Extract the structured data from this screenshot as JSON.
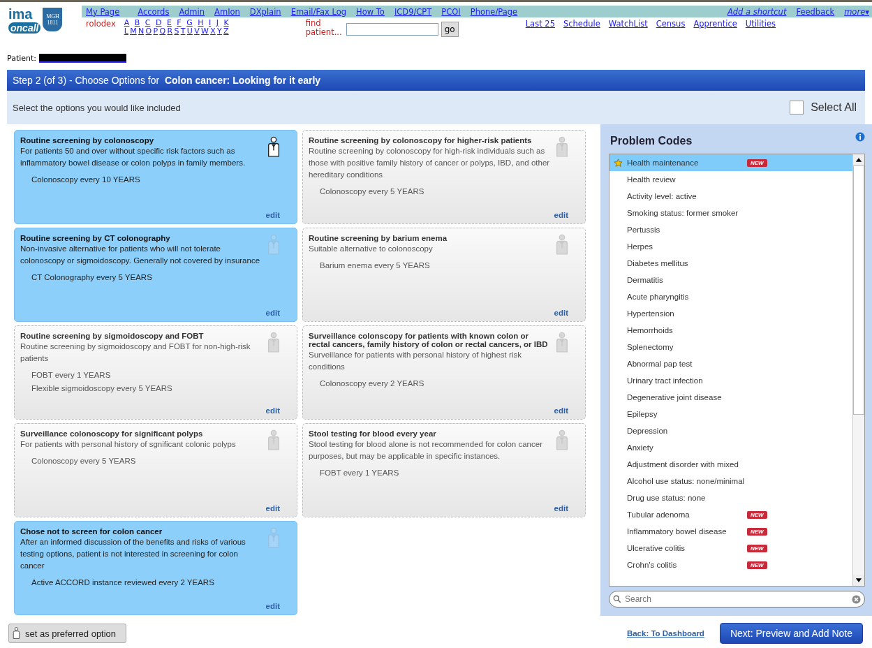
{
  "logo": {
    "line1": "ima",
    "line2": "oncall",
    "shield_top": "MGH",
    "shield_year": "1811"
  },
  "nav_links": [
    "My Page",
    "Accords",
    "Admin",
    "AmIon",
    "DXplain",
    "Email/Fax Log",
    "How To",
    "ICD9/CPT",
    "PCOI",
    "Phone/Page"
  ],
  "nav_right_links": [
    {
      "label": "Add a shortcut",
      "italic": true
    },
    {
      "label": "Feedback",
      "italic": false
    },
    {
      "label": "more▾",
      "italic": true
    }
  ],
  "rolodex": {
    "label": "rolodex",
    "first_line": [
      "A",
      "B",
      "C",
      "D",
      "E",
      "F",
      "G",
      "H",
      "I",
      "J",
      "K"
    ],
    "second_line": [
      "L",
      "M",
      "N",
      "O",
      "P",
      "Q",
      "R",
      "S",
      "T",
      "U",
      "V",
      "W",
      "X",
      "Y",
      "Z"
    ]
  },
  "find_patient": {
    "label": "find patient...",
    "button": "go"
  },
  "secondary_links": [
    "Last 25",
    "Schedule",
    "WatchList",
    "Census",
    "Apprentice",
    "Utilities"
  ],
  "patient_label": "Patient:",
  "step": {
    "prefix": "Step 2 (of 3) - Choose Options for",
    "topic": "Colon cancer: Looking for it early"
  },
  "instruction": "Select the options you would like included",
  "select_all": {
    "label": "Select All",
    "checked": false
  },
  "cards": [
    {
      "title": "Routine screening by colonoscopy",
      "description": "For patients 50 and over without specific risk factors such as inflammatory bowel disease or colon polyps in family members.",
      "schedules": [
        "Colonoscopy every 10 YEARS"
      ],
      "edit": "edit",
      "selected": true,
      "preferred": true
    },
    {
      "title": "Routine screening by colonoscopy for higher-risk patients",
      "description": "Routine screening by colonoscopy for high-risk individuals such as those with positive family history of cancer or polyps, IBD, and other hereditary conditions",
      "schedules": [
        "Colonoscopy every 5 YEARS"
      ],
      "edit": "edit",
      "selected": false,
      "preferred": false
    },
    {
      "title": "Routine screening by CT colonography",
      "description": "Non-invasive alternative for patients who will not tolerate colonoscopy or sigmoidoscopy.  Generally not covered by insurance",
      "schedules": [
        "CT Colonography every 5 YEARS"
      ],
      "edit": "edit",
      "selected": true,
      "preferred": false
    },
    {
      "title": "Routine screening by barium enema",
      "description": "Suitable alternative to colonoscopy",
      "schedules": [
        "Barium enema every 5 YEARS"
      ],
      "edit": "edit",
      "selected": false,
      "preferred": false
    },
    {
      "title": "Routine screening by sigmoidoscopy and FOBT",
      "description": "Routine screening by sigmoidoscopy and FOBT for non-high-risk patients",
      "schedules": [
        "FOBT every 1 YEARS",
        "Flexible sigmoidoscopy every 5 YEARS"
      ],
      "edit": "edit",
      "selected": false,
      "preferred": false
    },
    {
      "title": "Surveillance colonscopy for patients with known colon or rectal cancers,  family history of colon or rectal cancers, or IBD",
      "description": "Surveillance for patients with personal history of highest risk conditions",
      "schedules": [
        "Colonoscopy every 2 YEARS"
      ],
      "edit": "edit",
      "selected": false,
      "preferred": false
    },
    {
      "title": "Surveillance colonoscopy for significant polyps",
      "description": "For patients with personal history of sgnificant colonic polyps",
      "schedules": [
        "Colonoscopy every 5 YEARS"
      ],
      "edit": "edit",
      "selected": false,
      "preferred": false
    },
    {
      "title": "Stool testing for blood every year",
      "description": "Stool testing for blood alone is not recommended for colon cancer purposes, but may be applicable in specific instances.",
      "schedules": [
        "FOBT every 1 YEARS"
      ],
      "edit": "edit",
      "selected": false,
      "preferred": false
    },
    {
      "title": "Chose not to screen for colon cancer",
      "description": "After an informed discussion of the benefits and risks of various testing options, patient is not interested in screening for colon cancer",
      "schedules": [
        "Active ACCORD instance reviewed every 2 YEARS"
      ],
      "edit": "edit",
      "selected": true,
      "preferred": false
    }
  ],
  "problem_codes": {
    "title": "Problem Codes",
    "search": {
      "placeholder": "Search"
    },
    "items": [
      {
        "name": "Health maintenance",
        "new": "NEW",
        "starred": true,
        "selected": true
      },
      {
        "name": "Health review",
        "starred": false,
        "selected": false
      },
      {
        "name": "Activity level: active",
        "starred": false,
        "selected": false
      },
      {
        "name": "Smoking status: former smoker",
        "starred": false,
        "selected": false
      },
      {
        "name": "Pertussis",
        "starred": false,
        "selected": false
      },
      {
        "name": "Herpes",
        "starred": false,
        "selected": false
      },
      {
        "name": "Diabetes mellitus",
        "starred": false,
        "selected": false
      },
      {
        "name": "Dermatitis",
        "starred": false,
        "selected": false
      },
      {
        "name": "Acute pharyngitis",
        "starred": false,
        "selected": false
      },
      {
        "name": "Hypertension",
        "starred": false,
        "selected": false
      },
      {
        "name": "Hemorrhoids",
        "starred": false,
        "selected": false
      },
      {
        "name": "Splenectomy",
        "starred": false,
        "selected": false
      },
      {
        "name": "Abnormal pap test",
        "starred": false,
        "selected": false
      },
      {
        "name": "Urinary tract infection",
        "starred": false,
        "selected": false
      },
      {
        "name": "Degenerative joint disease",
        "starred": false,
        "selected": false
      },
      {
        "name": "Epilepsy",
        "starred": false,
        "selected": false
      },
      {
        "name": "Depression",
        "starred": false,
        "selected": false
      },
      {
        "name": "Anxiety",
        "starred": false,
        "selected": false
      },
      {
        "name": "Adjustment disorder with mixed",
        "starred": false,
        "selected": false
      },
      {
        "name": "Alcohol use status: none/minimal",
        "starred": false,
        "selected": false
      },
      {
        "name": "Drug use status: none",
        "starred": false,
        "selected": false
      },
      {
        "name": "Tubular adenoma",
        "new": "NEW",
        "starred": false,
        "selected": false
      },
      {
        "name": "Inflammatory bowel disease",
        "new": "NEW",
        "starred": false,
        "selected": false
      },
      {
        "name": "Ulcerative colitis",
        "new": "NEW",
        "starred": false,
        "selected": false
      },
      {
        "name": "Crohn's colitis",
        "new": "NEW",
        "starred": false,
        "selected": false
      }
    ]
  },
  "footer": {
    "preferred_button": "set as preferred option",
    "back_link": "Back: To Dashboard",
    "next_button": "Next: Preview and Add Note"
  }
}
